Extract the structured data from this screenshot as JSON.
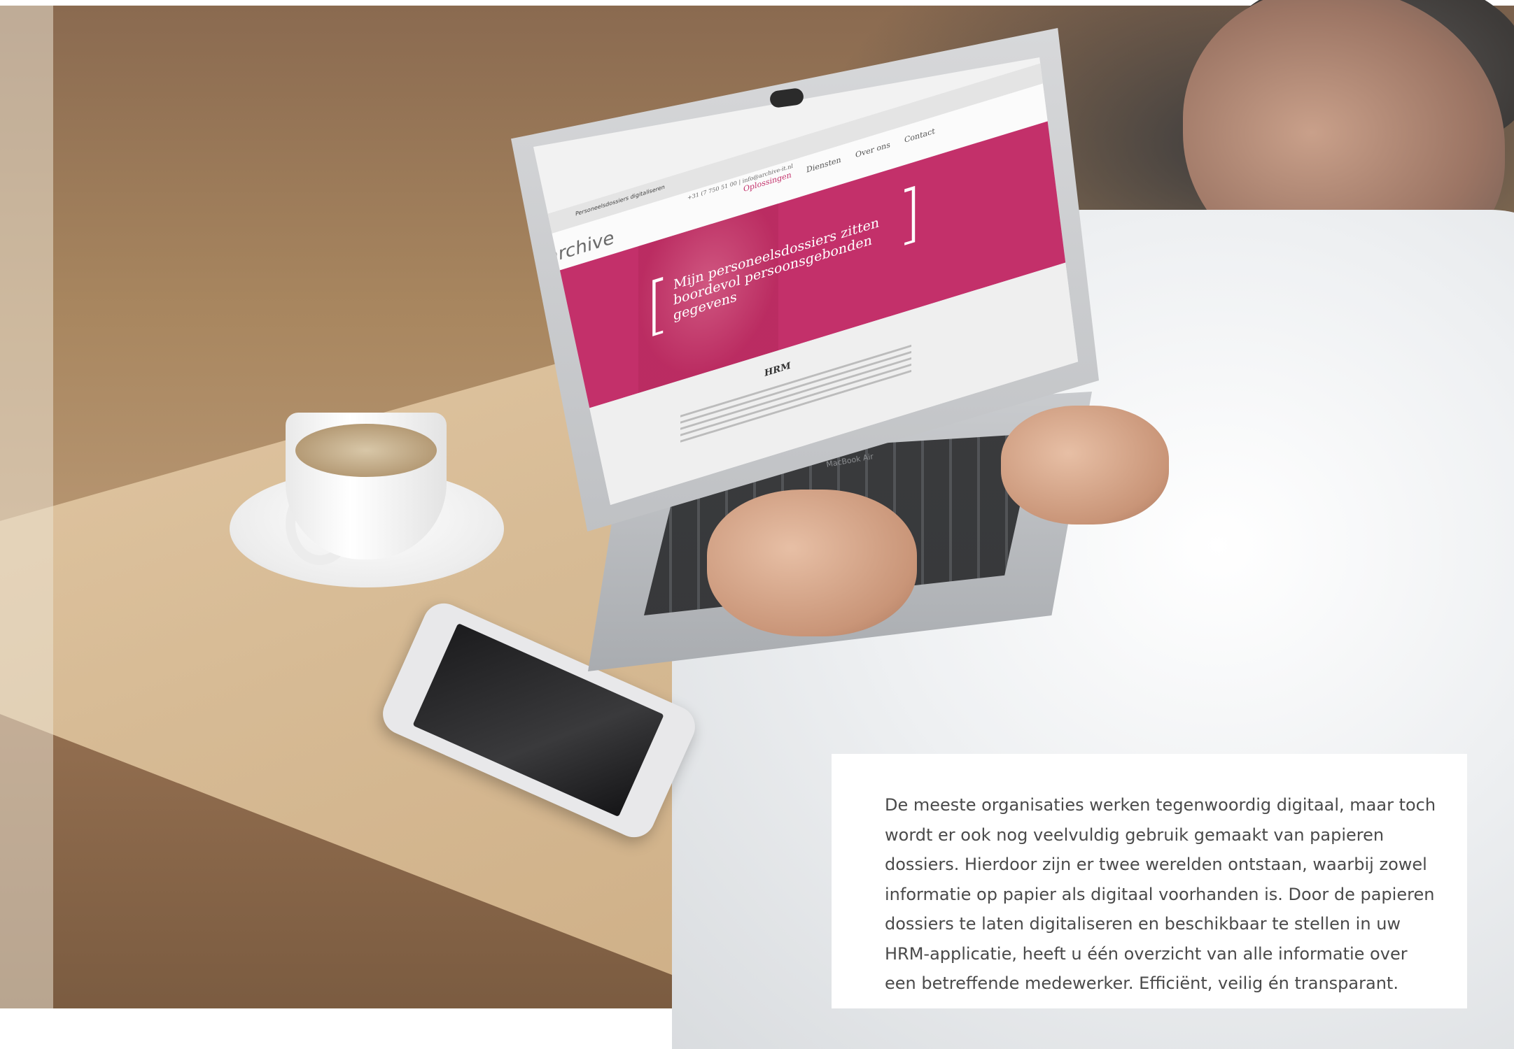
{
  "laptop": {
    "browser_tab": "Personeelsdossiers digitaliseren",
    "contact_line": "+31 (7 750 51 00 | info@archive-it.nl",
    "logo_text": "archive",
    "nav_items": [
      "Oplossingen",
      "Diensten",
      "Over ons",
      "Contact"
    ],
    "hero_title": "Mijn personeelsdossiers zitten boordevol persoonsgebonden gegevens",
    "section_title": "HRM",
    "brand_label": "MacBook Air"
  },
  "card": {
    "text": "De meeste organisaties werken tegenwoordig digitaal, maar toch wordt er ook nog veelvuldig gebruik gemaakt van papieren dossiers. Hierdoor zijn er twee werelden ontstaan, waarbij zowel informatie op papier als digitaal voorhanden is. Door de papieren dossiers te laten digitaliseren en beschikbaar te stellen in uw HRM-applicatie, heeft u één overzicht van alle informatie over een betreffende medewerker. Efficiënt, veilig én transparant."
  },
  "colors": {
    "brand_magenta": "#c3306a",
    "card_background": "#ffffff",
    "text": "#4a4a4a"
  }
}
